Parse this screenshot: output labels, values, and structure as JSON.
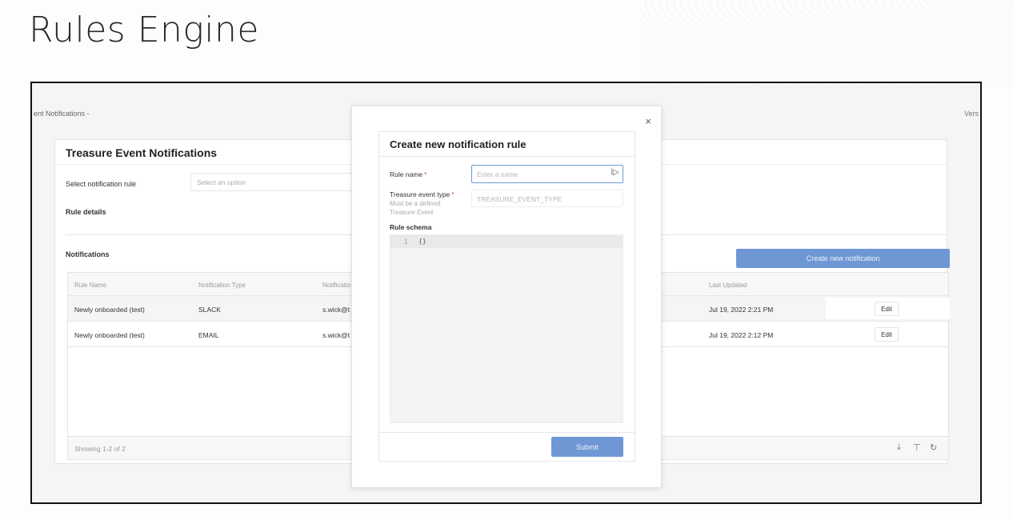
{
  "slide": {
    "title": "Rules Engine"
  },
  "app": {
    "breadcrumb": "ent Notifications  -",
    "version_text": "Vers",
    "title": "Treasure Event Notifications",
    "select_rule": {
      "label": "Select notification rule",
      "placeholder": "Select an option"
    },
    "rule_details_label": "Rule details",
    "notifications_label": "Notifications",
    "create_button": "Create new notification",
    "table": {
      "columns": [
        "Rule Name",
        "Notification Type",
        "Notificatio",
        "Last Updated"
      ],
      "rows": [
        {
          "rule_name": "Newly onboarded (test)",
          "type": "SLACK",
          "target": "s.wick@t",
          "last_updated": "Jul 19, 2022 2:21 PM",
          "action": "Edit"
        },
        {
          "rule_name": "Newly onboarded (test)",
          "type": "EMAIL",
          "target": "s.wick@t",
          "last_updated": "Jul 19, 2022 2:12 PM",
          "action": "Edit"
        }
      ],
      "footer": "Showing 1-2 of 2",
      "footer_icons": [
        "download-icon",
        "filter-icon",
        "refresh-icon"
      ]
    }
  },
  "modal": {
    "close": "×",
    "title": "Create new notification rule",
    "rule_name": {
      "label": "Rule name",
      "placeholder": "Enter a name"
    },
    "event_type": {
      "label": "Treasure event type",
      "hint": "Must be a defined Treasure Event",
      "value": "TREASURE_EVENT_TYPE"
    },
    "schema": {
      "label": "Rule schema",
      "line_number": "1",
      "code": "{}"
    },
    "submit": "Submit",
    "required_mark": "*",
    "accent_color": "#6f97d4"
  }
}
